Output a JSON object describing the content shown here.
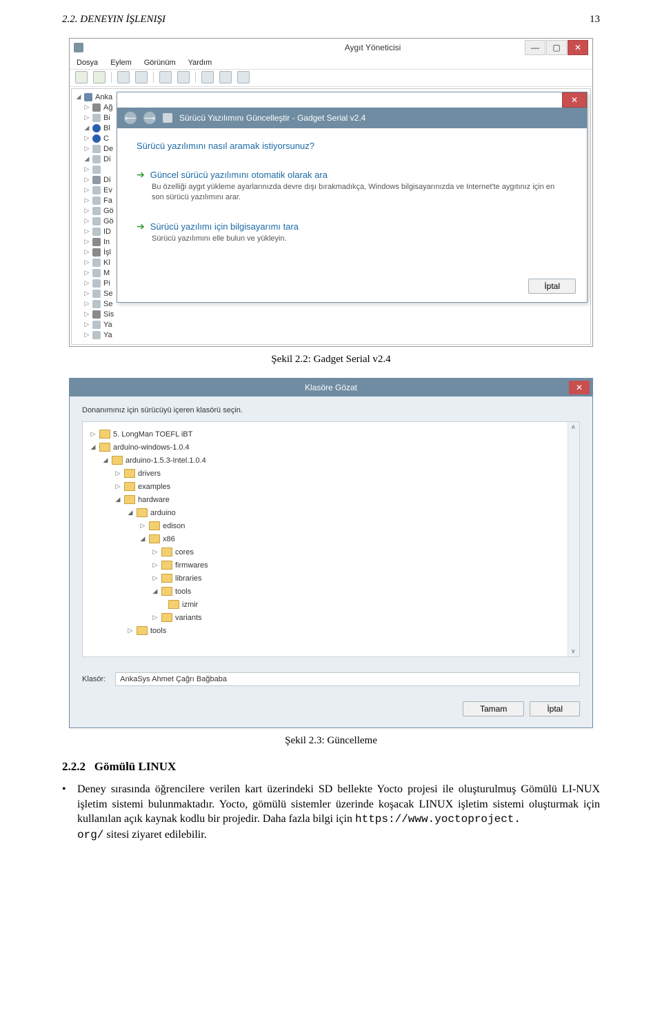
{
  "page": {
    "header_left": "2.2. DENEYIN İŞLENIŞI",
    "header_right": "13"
  },
  "dm": {
    "title": "Aygıt Yöneticisi",
    "menu": [
      "Dosya",
      "Eylem",
      "Görünüm",
      "Yardım"
    ],
    "tree": [
      {
        "t": "open",
        "i": "i-pc",
        "txt": "Anka"
      },
      {
        "t": "closed",
        "i": "i-chip",
        "txt": "Ağ"
      },
      {
        "t": "closed",
        "i": "i-gen",
        "txt": "Bi"
      },
      {
        "t": "open",
        "i": "i-bt",
        "txt": "Bl"
      },
      {
        "t": "closed",
        "i": "i-bt",
        "txt": "C"
      },
      {
        "t": "closed",
        "i": "i-gen",
        "txt": "De"
      },
      {
        "t": "open",
        "i": "i-gen",
        "txt": "Di"
      },
      {
        "t": "closed",
        "i": "i-gen",
        "txt": ""
      },
      {
        "t": "closed",
        "i": "i-hdd",
        "txt": "Di"
      },
      {
        "t": "closed",
        "i": "i-gen",
        "txt": "Ev"
      },
      {
        "t": "closed",
        "i": "i-gen",
        "txt": "Fa"
      },
      {
        "t": "closed",
        "i": "i-gen",
        "txt": "Gö"
      },
      {
        "t": "closed",
        "i": "i-gen",
        "txt": "Gö"
      },
      {
        "t": "closed",
        "i": "i-gen",
        "txt": "ID"
      },
      {
        "t": "closed",
        "i": "i-chip",
        "txt": "In"
      },
      {
        "t": "closed",
        "i": "i-chip",
        "txt": "İşl"
      },
      {
        "t": "closed",
        "i": "i-gen",
        "txt": "Kl"
      },
      {
        "t": "closed",
        "i": "i-gen",
        "txt": "M"
      },
      {
        "t": "closed",
        "i": "i-gen",
        "txt": "Pi"
      },
      {
        "t": "closed",
        "i": "i-gen",
        "txt": "Se"
      },
      {
        "t": "closed",
        "i": "i-gen",
        "txt": "Se"
      },
      {
        "t": "closed",
        "i": "i-chip",
        "txt": "Sis"
      },
      {
        "t": "closed",
        "i": "i-gen",
        "txt": "Ya"
      },
      {
        "t": "closed",
        "i": "i-gen",
        "txt": "Ya"
      }
    ]
  },
  "wiz": {
    "header": "Sürücü Yazılımını Güncelleştir - Gadget Serial v2.4",
    "question": "Sürücü yazılımını nasıl aramak istiyorsunuz?",
    "opt1_title": "Güncel sürücü yazılımını otomatik olarak ara",
    "opt1_desc": "Bu özelliği aygıt yükleme ayarlarınızda devre dışı bırakmadıkça, Windows bilgisayarınızda ve Internet'te aygıtınız için en son sürücü yazılımını arar.",
    "opt2_title": "Sürücü yazılımı için bilgisayarımı tara",
    "opt2_desc": "Sürücü yazılımını elle bulun ve yükleyin.",
    "cancel": "İptal"
  },
  "caption1": "Şekil 2.2: Gadget Serial v2.4",
  "bf": {
    "title": "Klasöre Gözat",
    "instruction": "Donanımınız için sürücüyü içeren klasörü seçin.",
    "tree": [
      {
        "d": 1,
        "tri": "▷",
        "txt": "5. LongMan TOEFL iBT"
      },
      {
        "d": 1,
        "tri": "◢",
        "txt": "arduino-windows-1.0.4"
      },
      {
        "d": 2,
        "tri": "◢",
        "txt": "arduino-1.5.3-Intel.1.0.4"
      },
      {
        "d": 3,
        "tri": "▷",
        "txt": "drivers"
      },
      {
        "d": 3,
        "tri": "▷",
        "txt": "examples"
      },
      {
        "d": 3,
        "tri": "◢",
        "txt": "hardware"
      },
      {
        "d": 4,
        "tri": "◢",
        "txt": "arduino"
      },
      {
        "d": 5,
        "tri": "▷",
        "txt": "edison"
      },
      {
        "d": 5,
        "tri": "◢",
        "txt": "x86"
      },
      {
        "d": 6,
        "tri": "▷",
        "txt": "cores"
      },
      {
        "d": 6,
        "tri": "▷",
        "txt": "firmwares"
      },
      {
        "d": 6,
        "tri": "▷",
        "txt": "libraries"
      },
      {
        "d": 6,
        "tri": "◢",
        "txt": "tools"
      },
      {
        "d": 6,
        "tri": "",
        "txt": "izmir",
        "indent_plus": 10
      },
      {
        "d": 6,
        "tri": "▷",
        "txt": "variants"
      },
      {
        "d": 4,
        "tri": "▷",
        "txt": "tools"
      }
    ],
    "klasor_label": "Klasör:",
    "klasor_value": "AnkaSys Ahmet Çağrı Bağbaba",
    "ok": "Tamam",
    "cancel": "İptal"
  },
  "caption2": "Şekil 2.3: Güncelleme",
  "section": {
    "number": "2.2.2",
    "title": "Gömülü LINUX",
    "bullet": "•",
    "para": "Deney sırasında öğrencilere verilen kart üzerindeki SD bellekte Yocto projesi ile oluşturulmuş Gömülü LI-NUX işletim sistemi bulunmaktadır. Yocto, gömülü sistemler üzerinde koşacak LINUX işletim sistemi oluşturmak için kullanılan açık kaynak kodlu bir projedir. Daha fazla bilgi için ",
    "url_1": "https://www.yoctoproject.",
    "url_2": "org/",
    "para_end": " sitesi ziyaret edilebilir."
  }
}
